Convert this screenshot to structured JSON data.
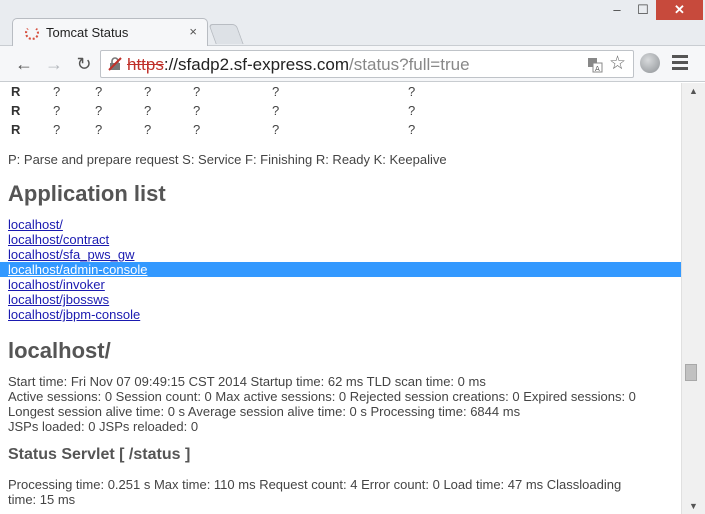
{
  "browser": {
    "tab_title": "Tomcat Status",
    "tab_close": "×",
    "url_scheme": "https",
    "url_host": "://sfadp2.sf-express.com",
    "url_path": "/status?full=true",
    "window_min": "–",
    "window_max": "☐",
    "window_close": "✕",
    "back": "←",
    "forward": "→",
    "reload": "↻",
    "star": "☆"
  },
  "workers": {
    "rows": [
      {
        "stage": "R",
        "cols": [
          "?",
          "?",
          "?",
          "?",
          "?",
          "?"
        ]
      },
      {
        "stage": "R",
        "cols": [
          "?",
          "?",
          "?",
          "?",
          "?",
          "?"
        ]
      },
      {
        "stage": "R",
        "cols": [
          "?",
          "?",
          "?",
          "?",
          "?",
          "?"
        ]
      }
    ],
    "legend": "P: Parse and prepare request S: Service F: Finishing R: Ready K: Keepalive"
  },
  "applications": {
    "heading": "Application list",
    "links": [
      "localhost/",
      "localhost/contract",
      "localhost/sfa_pws_gw",
      "localhost/admin-console",
      "localhost/invoker",
      "localhost/jbossws",
      "localhost/jbpm-console"
    ]
  },
  "host_section": {
    "heading": "localhost/",
    "lines": [
      "Start time: Fri Nov 07 09:49:15 CST 2014 Startup time: 62 ms TLD scan time: 0 ms",
      "Active sessions: 0 Session count: 0 Max active sessions: 0 Rejected session creations: 0 Expired sessions: 0",
      "Longest session alive time: 0 s Average session alive time: 0 s Processing time: 6844 ms",
      "JSPs loaded: 0 JSPs reloaded: 0"
    ]
  },
  "servlet_section": {
    "heading": "Status Servlet [ /status ]",
    "lines": [
      "Processing time: 0.251 s Max time: 110 ms Request count: 4 Error count: 0 Load time: 47 ms Classloading",
      "time: 15 ms"
    ]
  },
  "scrollbar": {
    "up": "▲",
    "down": "▼"
  }
}
